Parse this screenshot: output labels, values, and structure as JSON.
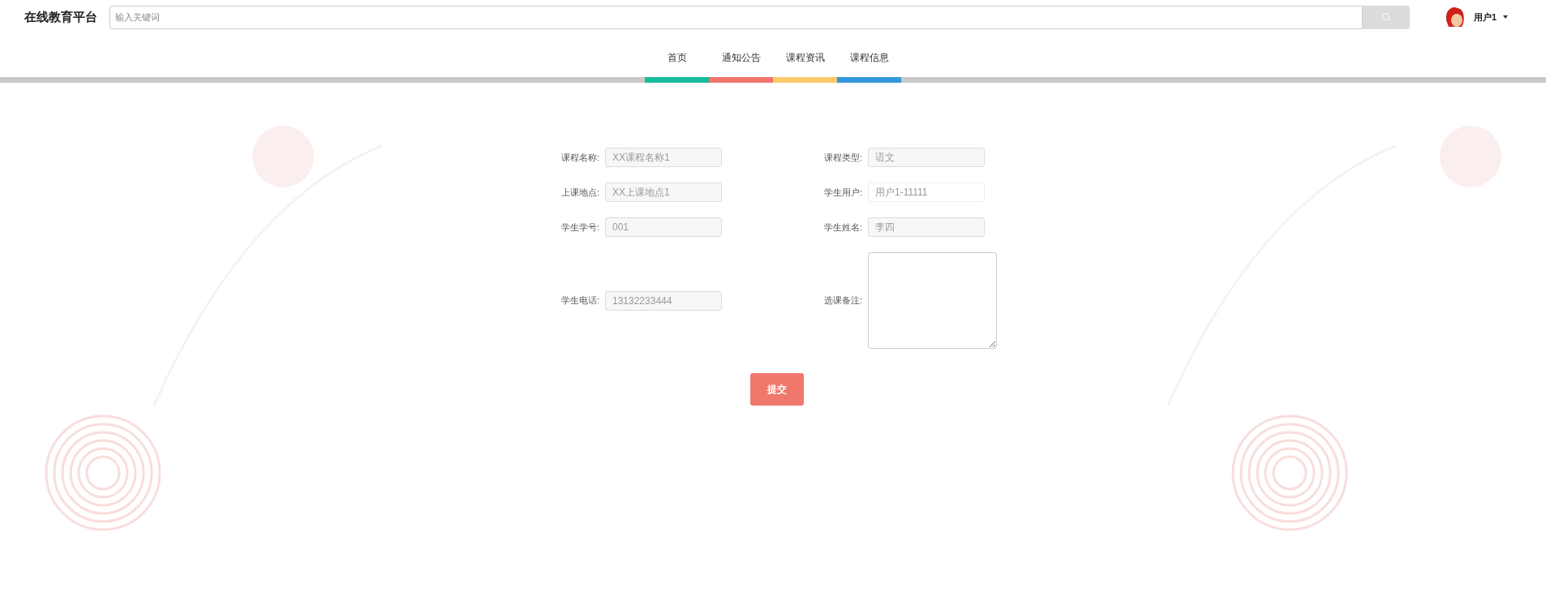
{
  "header": {
    "site_title": "在线教育平台",
    "search": {
      "placeholder": "输入关键词"
    },
    "user": {
      "name": "用户1"
    }
  },
  "nav": [
    {
      "label": "首页",
      "color": "#1abc9c"
    },
    {
      "label": "通知公告",
      "color": "#f0776c"
    },
    {
      "label": "课程资讯",
      "color": "#fcca6c"
    },
    {
      "label": "课程信息",
      "color": "#3498db"
    }
  ],
  "form": {
    "fields": [
      {
        "kind": "input",
        "label": "课程名称:",
        "value": "XX课程名称1",
        "disabled": true
      },
      {
        "kind": "input",
        "label": "课程类型:",
        "value": "语文",
        "disabled": true
      },
      {
        "kind": "input",
        "label": "上课地点:",
        "value": "XX上课地点1",
        "disabled": true
      },
      {
        "kind": "input",
        "label": "学生用户:",
        "value": "用户1-11111",
        "disabled": false
      },
      {
        "kind": "input",
        "label": "学生学号:",
        "value": "001",
        "disabled": true
      },
      {
        "kind": "input",
        "label": "学生姓名:",
        "value": "李四",
        "disabled": true
      },
      {
        "kind": "input",
        "label": "学生电话:",
        "value": "13132233444",
        "disabled": true
      },
      {
        "kind": "textarea",
        "label": "选课备注:"
      }
    ],
    "submit": "提交"
  }
}
